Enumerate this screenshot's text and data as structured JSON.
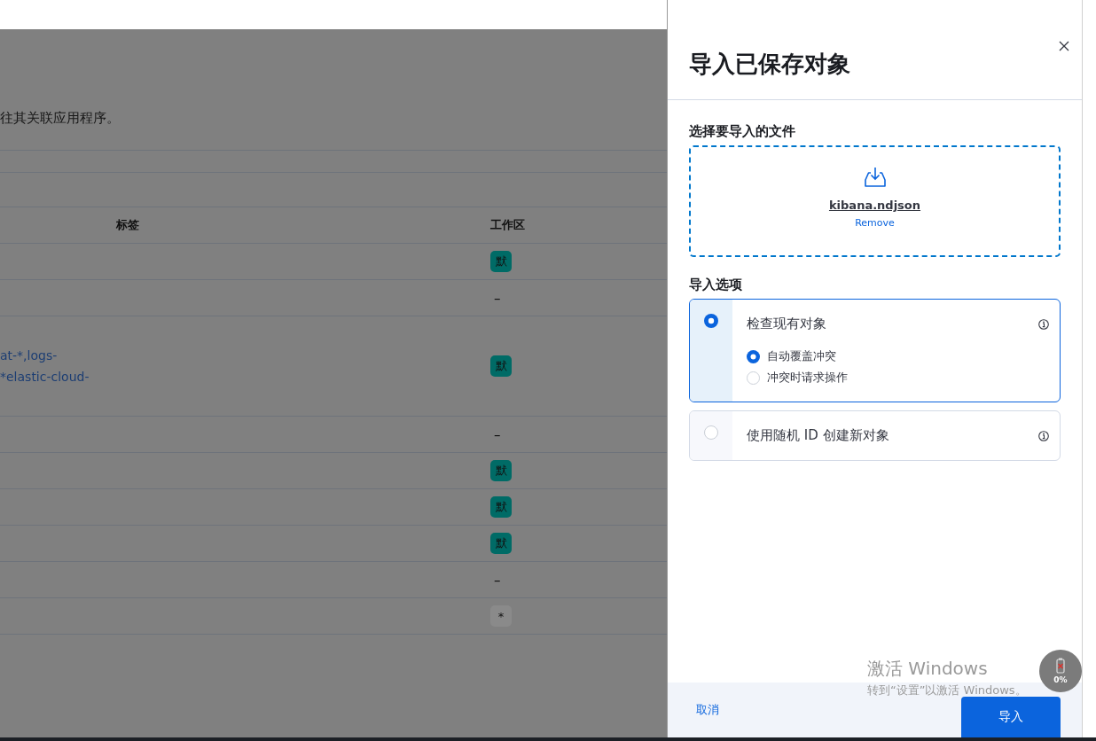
{
  "background_page": {
    "description": "往其关联应用程序。",
    "table": {
      "columns": [
        "标签",
        "工作区"
      ],
      "rows": [
        {
          "workspace": {
            "kind": "badge",
            "text": "默"
          }
        },
        {
          "workspace": {
            "kind": "dash",
            "text": "–"
          }
        },
        {
          "tags": [
            "at-*,logs-",
            "*elastic-cloud-"
          ],
          "workspace": {
            "kind": "badge",
            "text": "默"
          }
        },
        {
          "workspace": {
            "kind": "dash",
            "text": "–"
          }
        },
        {
          "workspace": {
            "kind": "badge",
            "text": "默"
          }
        },
        {
          "workspace": {
            "kind": "badge",
            "text": "默"
          }
        },
        {
          "workspace": {
            "kind": "badge",
            "text": "默"
          }
        },
        {
          "workspace": {
            "kind": "dash",
            "text": "–"
          }
        },
        {
          "workspace": {
            "kind": "badge_gray",
            "text": "*"
          }
        }
      ]
    }
  },
  "flyout": {
    "title": "导入已保存对象",
    "file_section": {
      "label": "选择要导入的文件",
      "filename": "kibana.ndjson",
      "remove": "Remove"
    },
    "options_label": "导入选项",
    "options": [
      {
        "label": "检查现有对象",
        "selected": true,
        "children": [
          {
            "label": "自动覆盖冲突",
            "selected": true
          },
          {
            "label": "冲突时请求操作",
            "selected": false
          }
        ]
      },
      {
        "label": "使用随机 ID 创建新对象",
        "selected": false
      }
    ],
    "footer": {
      "cancel": "取消",
      "import": "导入"
    }
  },
  "os_overlay": {
    "activation_title": "激活 Windows",
    "activation_hint": "转到“设置”以激活 Windows。",
    "widget_reading": "0%"
  }
}
